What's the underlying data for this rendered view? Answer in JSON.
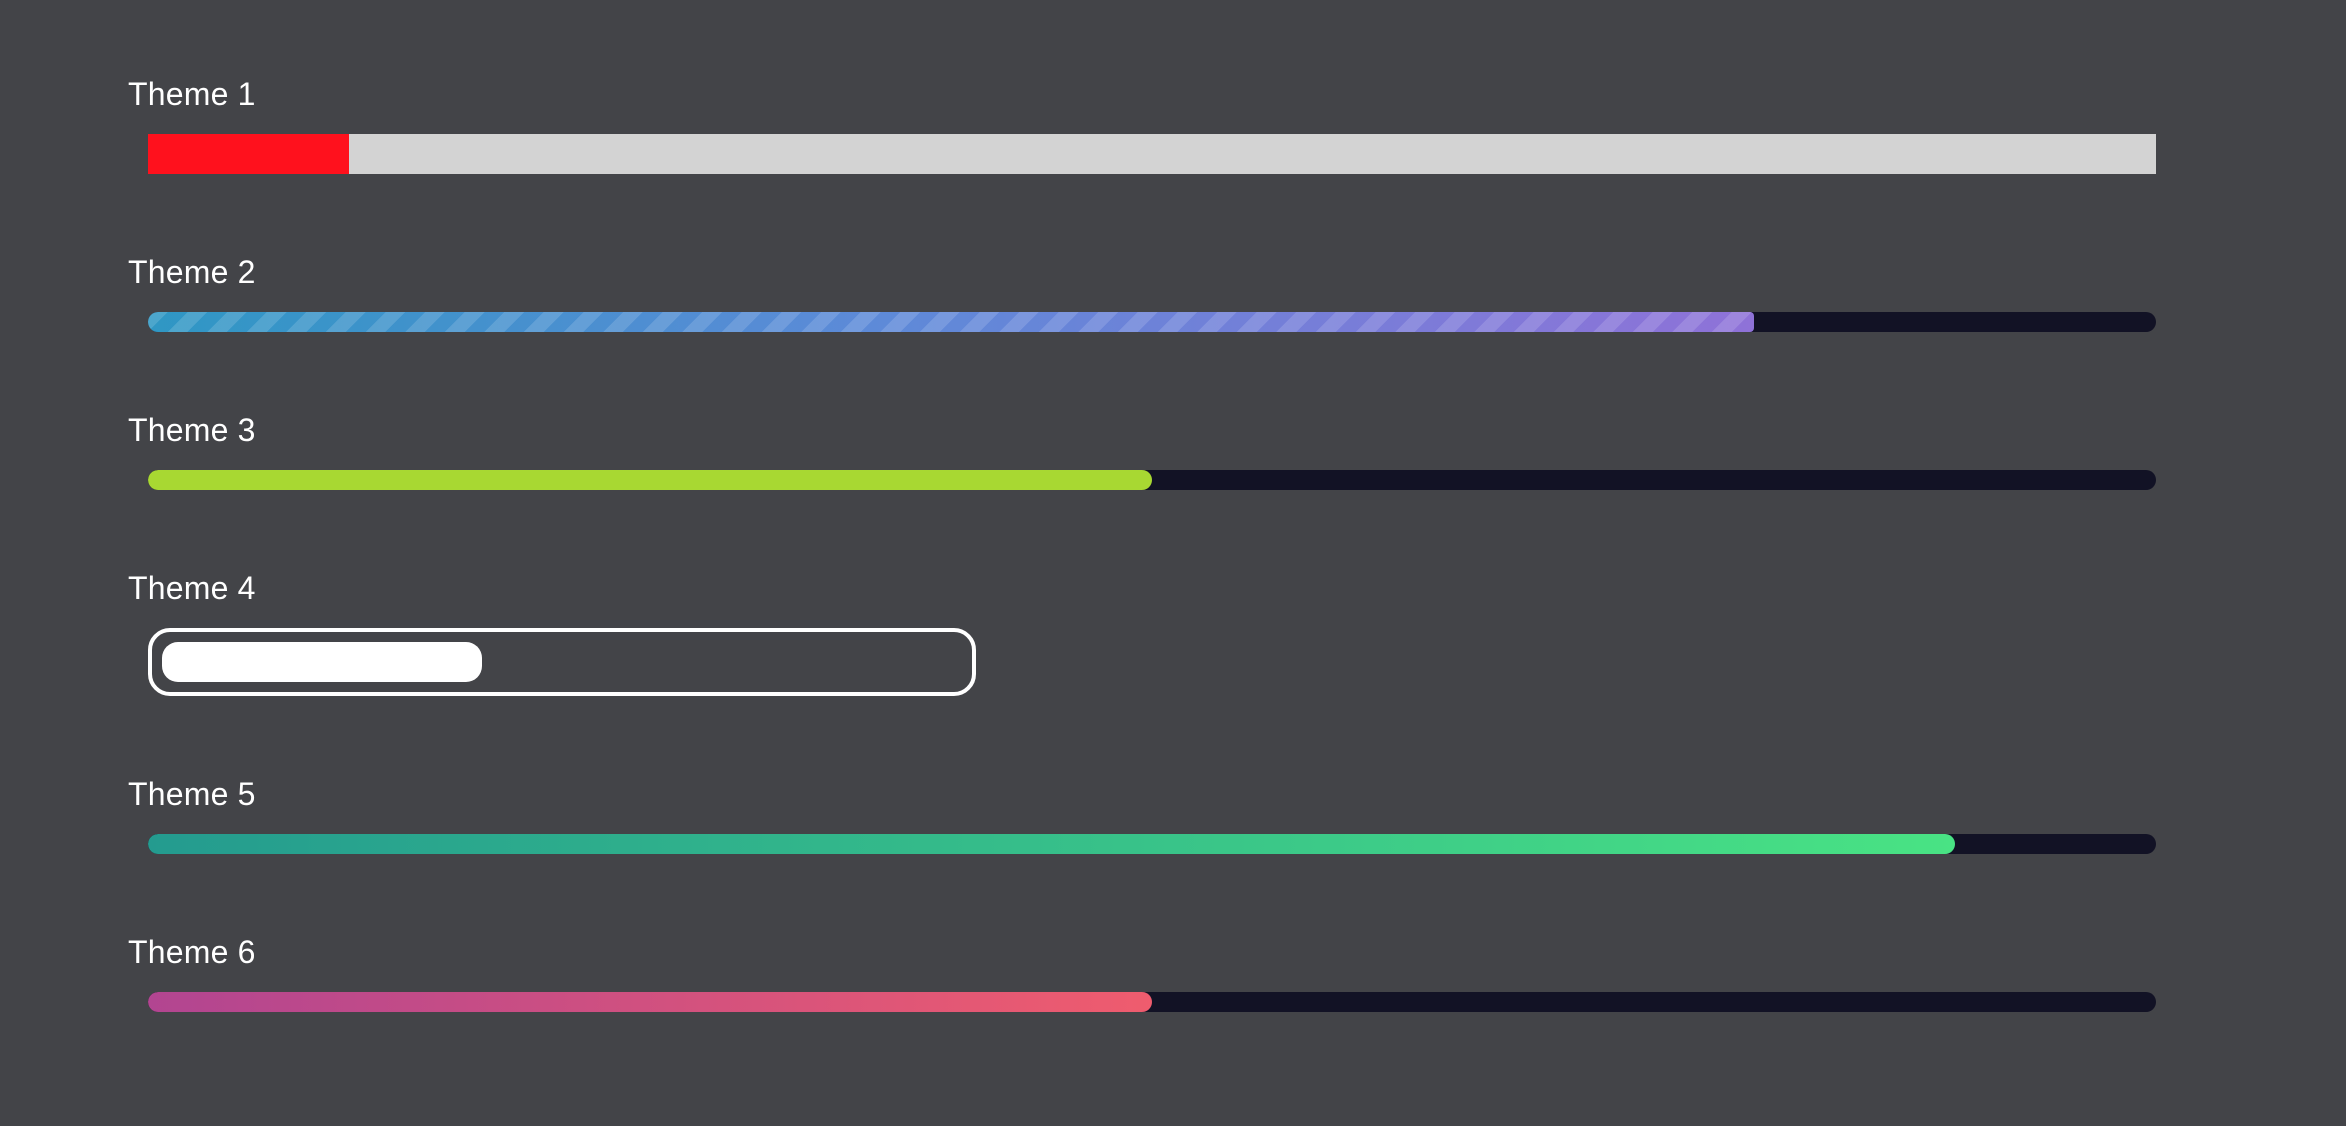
{
  "themes": [
    {
      "label": "Theme 1",
      "progress": 0.1,
      "colors": {
        "fill": "#ff111d",
        "track": "#d3d3d3"
      }
    },
    {
      "label": "Theme 2",
      "progress": 0.8,
      "colors": {
        "fill_start": "#2f97c4",
        "fill_end": "#8f72d8",
        "track": "#121225"
      }
    },
    {
      "label": "Theme 3",
      "progress": 0.5,
      "colors": {
        "fill": "#a8d832",
        "track": "#121225"
      }
    },
    {
      "label": "Theme 4",
      "progress": 0.4,
      "colors": {
        "fill": "#ffffff",
        "border": "#ffffff"
      }
    },
    {
      "label": "Theme 5",
      "progress": 0.9,
      "colors": {
        "fill_start": "#249b8f",
        "fill_end": "#49e384",
        "track": "#121225"
      }
    },
    {
      "label": "Theme 6",
      "progress": 0.5,
      "colors": {
        "fill_start": "#b24591",
        "fill_end": "#ef5c6e",
        "track": "#121225"
      }
    }
  ],
  "colors": {
    "background": "#434448",
    "text": "#ffffff"
  }
}
